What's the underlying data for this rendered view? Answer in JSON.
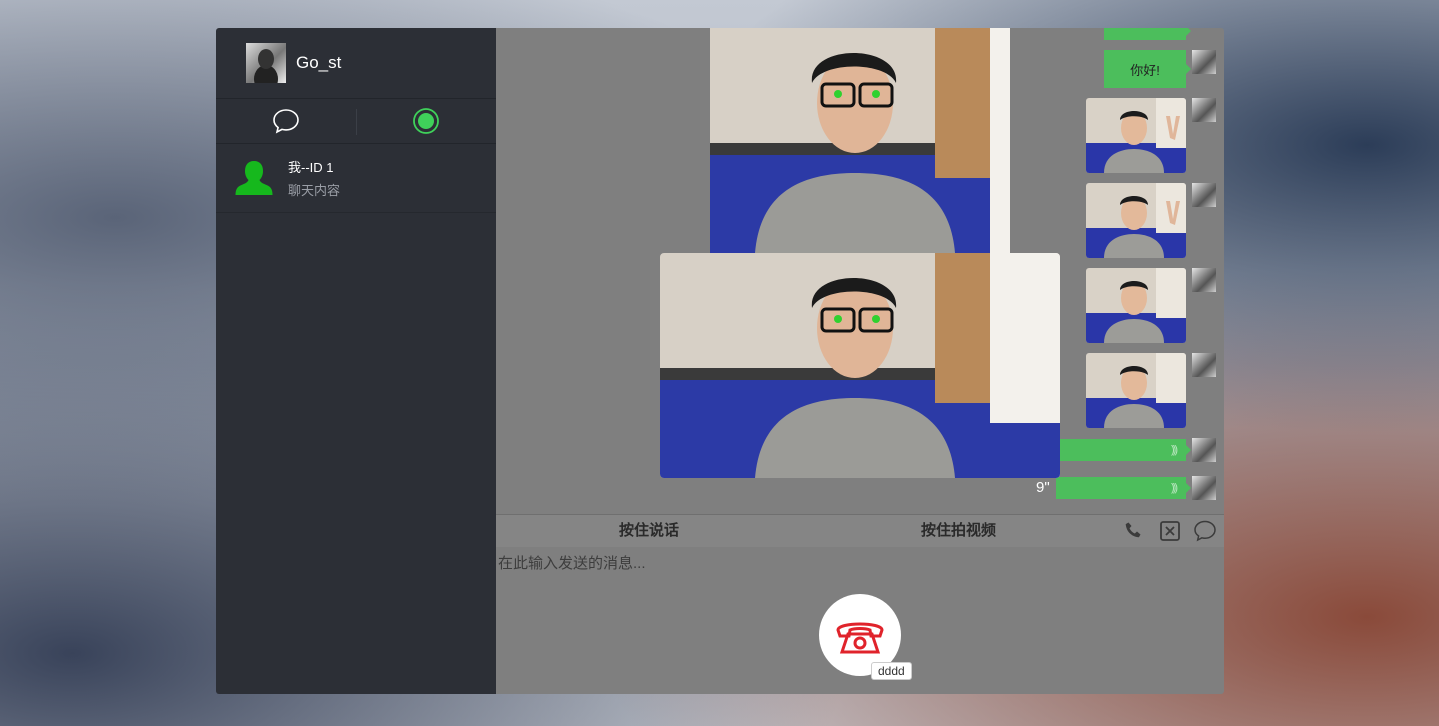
{
  "user": {
    "name": "Go_st"
  },
  "contacts": [
    {
      "name": "我--ID 1",
      "preview": "聊天内容"
    }
  ],
  "messages": {
    "text_reply": "你好!",
    "voice_duration": "9\""
  },
  "toolbar": {
    "hold_to_talk": "按住说话",
    "hold_to_record_video": "按住拍视频"
  },
  "composer": {
    "placeholder": "在此输入发送的消息..."
  },
  "call": {
    "tooltip": "dddd"
  },
  "colors": {
    "accent_green": "#4cbe5c",
    "hangup_red": "#e0232b",
    "sidebar": "#2c2f36"
  }
}
